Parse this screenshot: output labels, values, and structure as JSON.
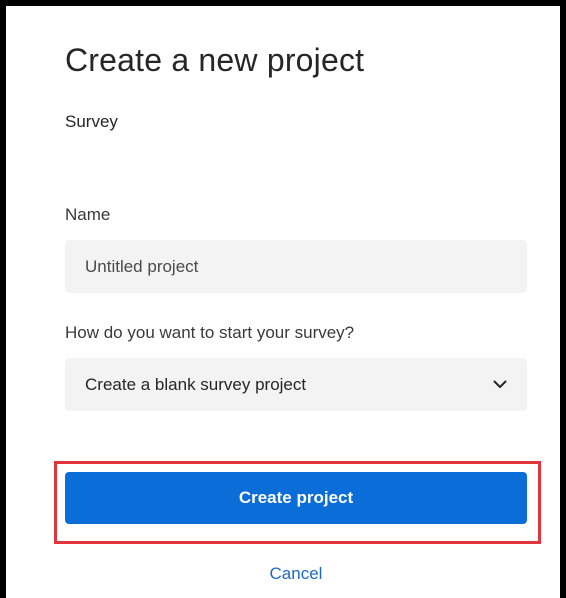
{
  "dialog": {
    "title": "Create a new project",
    "project_type": "Survey"
  },
  "name_field": {
    "label": "Name",
    "placeholder": "Untitled project",
    "value": ""
  },
  "start_field": {
    "label": "How do you want to start your survey?",
    "selected": "Create a blank survey project",
    "icon": "chevron-down-icon"
  },
  "actions": {
    "create_label": "Create project",
    "cancel_label": "Cancel"
  },
  "colors": {
    "primary": "#0b6ed8",
    "highlight": "#e2353b",
    "link": "#1f6ac0",
    "field_bg": "#f3f3f3"
  }
}
